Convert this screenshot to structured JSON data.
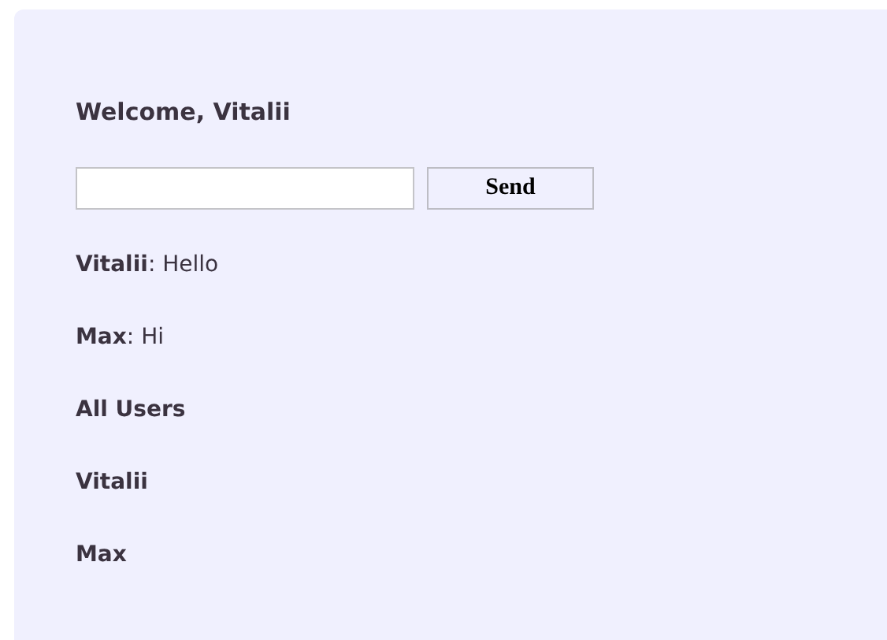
{
  "heading": "Welcome, Vitalii",
  "send_button": "Send",
  "messages": [
    {
      "text": "**Vitalii**: Hello"
    },
    {
      "text": "**Max**: Hi"
    }
  ],
  "users_heading": "All Users",
  "users": [
    "Vitalii",
    "Max"
  ]
}
